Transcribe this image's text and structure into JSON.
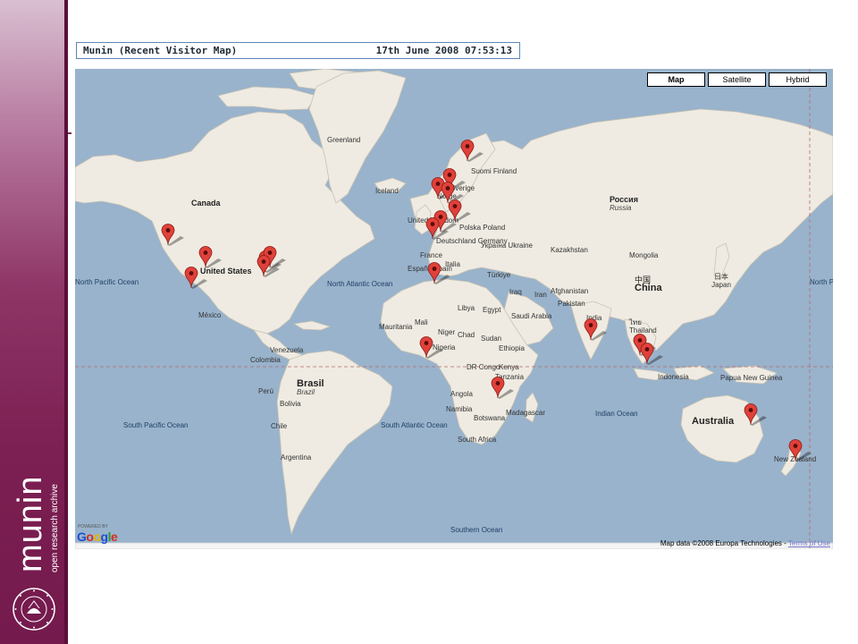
{
  "header": {
    "title": "Munin (Recent Visitor Map)",
    "timestamp": "17th June 2008 07:53:13"
  },
  "brand": {
    "name": "munin",
    "tagline": "open research archive",
    "seal_text": "UNIVERSITETET I TROMSØ",
    "color": "#7c1f52"
  },
  "map": {
    "type_buttons": [
      {
        "label": "Map",
        "active": true
      },
      {
        "label": "Satellite",
        "active": false
      },
      {
        "label": "Hybrid",
        "active": false
      }
    ],
    "water_color": "#99b3cc",
    "land_color": "#efebe2",
    "marker_color": "#e0413a",
    "labels": {
      "greenland": "Greenland",
      "iceland": "Iceland",
      "canada": "Canada",
      "united_states": "United States",
      "mexico": "México",
      "north_pacific": "North Pacific Ocean",
      "north_pacific_right": "North Pacific",
      "north_atlantic": "North Atlantic Ocean",
      "venezuela": "Venezuela",
      "colombia": "Colombia",
      "peru": "Perú",
      "brazil": "Brasil",
      "brazil_sub": "Brazil",
      "bolivia": "Bolivia",
      "chile": "Chile",
      "argentina": "Argentina",
      "south_pacific": "South Pacific Ocean",
      "south_atlantic": "South Atlantic Ocean",
      "southern_ocean": "Southern Ocean",
      "indian_ocean": "Indian Ocean",
      "suomi": "Suomi Finland",
      "norge": "Norge",
      "sverige": "Sverige",
      "united_kingdom": "United Kingdom",
      "deutschland": "Deutschland Germany",
      "polska": "Polska Poland",
      "ukraina": "Україна Ukraine",
      "france": "France",
      "italia": "Italia",
      "espana": "España Spain",
      "turkiye": "Türkiye",
      "russia": "Россия",
      "russia_sub": "Russia",
      "kazakhstan": "Kazakhstan",
      "mongolia": "Mongolia",
      "china_native": "中国",
      "china": "China",
      "japan_native": "日本",
      "japan": "Japan",
      "iraq": "Iraq",
      "iran": "Iran",
      "afghanistan": "Afghanistan",
      "pakistan": "Pakistan",
      "india": "India",
      "thailand_native": "ไทย",
      "thailand": "Thailand",
      "indonesia": "Indonesia",
      "papua": "Papua New Guinea",
      "australia": "Australia",
      "new_zealand": "New Zealand",
      "mauritania": "Mauritania",
      "mali": "Mali",
      "niger": "Niger",
      "chad": "Chad",
      "nigeria": "Nigeria",
      "libya": "Libya",
      "egypt": "Egypt",
      "saudi": "Saudi Arabia",
      "sudan": "Sudan",
      "ethiopia": "Ethiopia",
      "kenya": "Kenya",
      "dr_congo": "DR Congo",
      "tanzania": "Tanzania",
      "angola": "Angola",
      "namibia": "Namibia",
      "botswana": "Botswana",
      "madagascar": "Madagascar",
      "south_africa": "South Africa"
    },
    "footer": {
      "powered_by": "POWERED BY",
      "google": "Google",
      "attribution": "Map data ©2008 Europa Technologies - ",
      "terms": "Terms of Use"
    }
  }
}
